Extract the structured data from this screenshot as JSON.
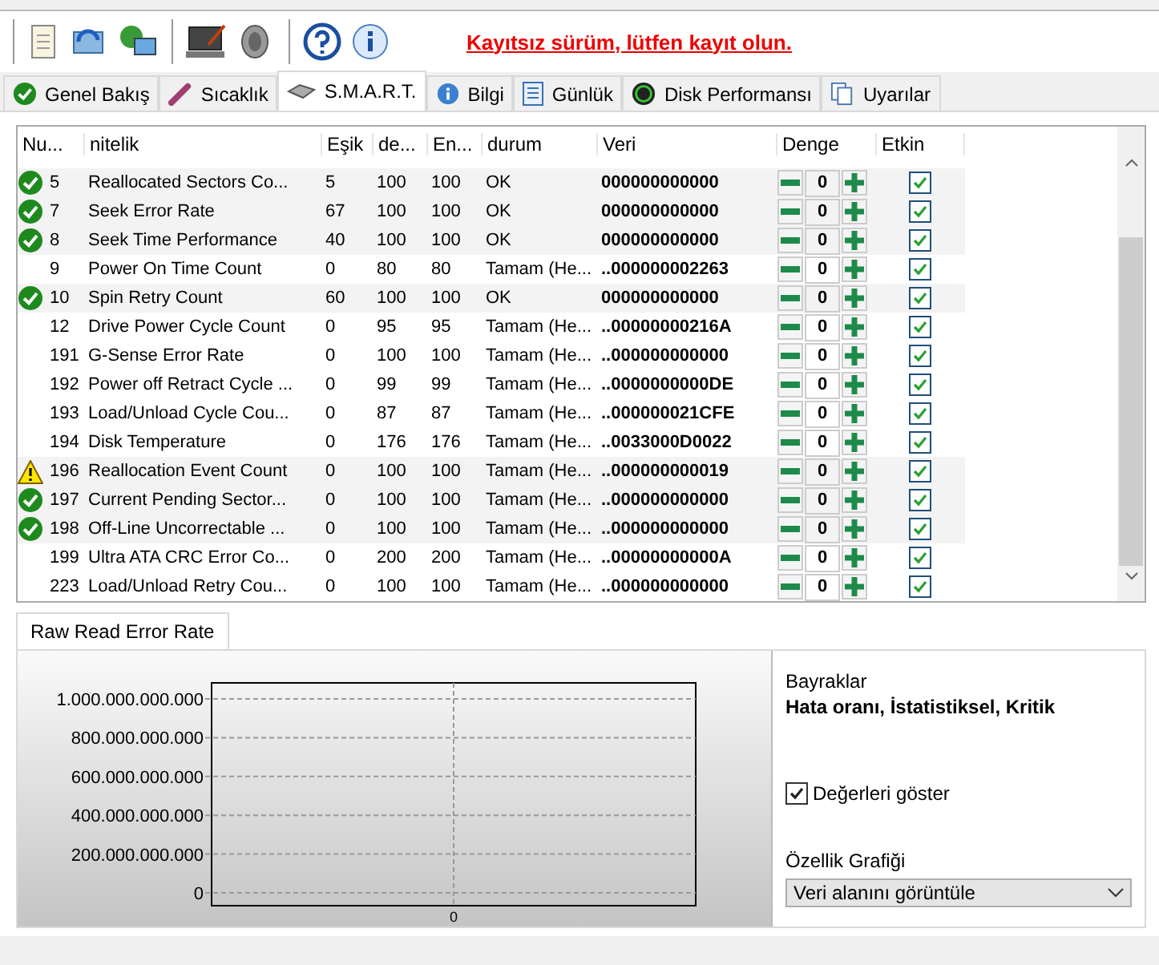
{
  "toolbar": {
    "notice": "Kayıtsız sürüm, lütfen kayıt olun."
  },
  "tabs": [
    {
      "label": "Genel Bakış",
      "selected": false
    },
    {
      "label": "Sıcaklık",
      "selected": false
    },
    {
      "label": "S.M.A.R.T.",
      "selected": true
    },
    {
      "label": "Bilgi",
      "selected": false
    },
    {
      "label": "Günlük",
      "selected": false
    },
    {
      "label": "Disk Performansı",
      "selected": false
    },
    {
      "label": "Uyarılar",
      "selected": false
    }
  ],
  "table": {
    "columns": [
      "Nu...",
      "nitelik",
      "Eşik",
      "de...",
      "En...",
      "durum",
      "Veri",
      "Denge",
      "Etkin"
    ],
    "rows": [
      {
        "kind": "ok",
        "cells": [
          "5",
          "Reallocated Sectors Co...",
          "5",
          "100",
          "100",
          "OK",
          "000000000000"
        ],
        "balance": "0",
        "enabled": true
      },
      {
        "kind": "ok",
        "cells": [
          "7",
          "Seek Error Rate",
          "67",
          "100",
          "100",
          "OK",
          "000000000000"
        ],
        "balance": "0",
        "enabled": true
      },
      {
        "kind": "ok",
        "cells": [
          "8",
          "Seek Time Performance",
          "40",
          "100",
          "100",
          "OK",
          "000000000000"
        ],
        "balance": "0",
        "enabled": true
      },
      {
        "kind": "plain",
        "cells": [
          "9",
          "Power On Time Count",
          "0",
          "80",
          "80",
          "Tamam (He...",
          "..000000002263"
        ],
        "balance": "0",
        "enabled": true
      },
      {
        "kind": "ok",
        "cells": [
          "10",
          "Spin Retry Count",
          "60",
          "100",
          "100",
          "OK",
          "000000000000"
        ],
        "balance": "0",
        "enabled": true
      },
      {
        "kind": "plain",
        "cells": [
          "12",
          "Drive Power Cycle Count",
          "0",
          "95",
          "95",
          "Tamam (He...",
          "..00000000216A"
        ],
        "balance": "0",
        "enabled": true
      },
      {
        "kind": "plain",
        "cells": [
          "191",
          "G-Sense Error Rate",
          "0",
          "100",
          "100",
          "Tamam (He...",
          "..000000000000"
        ],
        "balance": "0",
        "enabled": true
      },
      {
        "kind": "plain",
        "cells": [
          "192",
          "Power off Retract Cycle ...",
          "0",
          "99",
          "99",
          "Tamam (He...",
          "..0000000000DE"
        ],
        "balance": "0",
        "enabled": true
      },
      {
        "kind": "plain",
        "cells": [
          "193",
          "Load/Unload Cycle Cou...",
          "0",
          "87",
          "87",
          "Tamam (He...",
          "..000000021CFE"
        ],
        "balance": "0",
        "enabled": true
      },
      {
        "kind": "plain",
        "cells": [
          "194",
          "Disk Temperature",
          "0",
          "176",
          "176",
          "Tamam (He...",
          "..0033000D0022"
        ],
        "balance": "0",
        "enabled": true
      },
      {
        "kind": "warning",
        "cells": [
          "196",
          "Reallocation Event Count",
          "0",
          "100",
          "100",
          "Tamam (He...",
          "..000000000019"
        ],
        "balance": "0",
        "enabled": true
      },
      {
        "kind": "ok",
        "cells": [
          "197",
          "Current Pending Sector...",
          "0",
          "100",
          "100",
          "Tamam (He...",
          "..000000000000"
        ],
        "balance": "0",
        "enabled": true
      },
      {
        "kind": "ok",
        "cells": [
          "198",
          "Off-Line Uncorrectable ...",
          "0",
          "100",
          "100",
          "Tamam (He...",
          "..000000000000"
        ],
        "balance": "0",
        "enabled": true
      },
      {
        "kind": "plain",
        "cells": [
          "199",
          "Ultra ATA CRC Error Co...",
          "0",
          "200",
          "200",
          "Tamam (He...",
          "..00000000000A"
        ],
        "balance": "0",
        "enabled": true
      },
      {
        "kind": "plain",
        "cells": [
          "223",
          "Load/Unload Retry Cou...",
          "0",
          "100",
          "100",
          "Tamam (He...",
          "..000000000000"
        ],
        "balance": "0",
        "enabled": true
      }
    ]
  },
  "detail": {
    "tab": "Raw Read Error Rate",
    "y_labels": [
      "1.000.000.000.000",
      "800.000.000.000",
      "600.000.000.000",
      "400.000.000.000",
      "200.000.000.000",
      "0"
    ],
    "x_label": "0",
    "flags_label": "Bayraklar",
    "flags": "Hata oranı, İstatistiksel, Kritik",
    "show_values": {
      "label": "Değerleri göster",
      "checked": true
    },
    "graph_label": "Özellik Grafiği",
    "graph_select": "Veri alanını görüntüle"
  }
}
